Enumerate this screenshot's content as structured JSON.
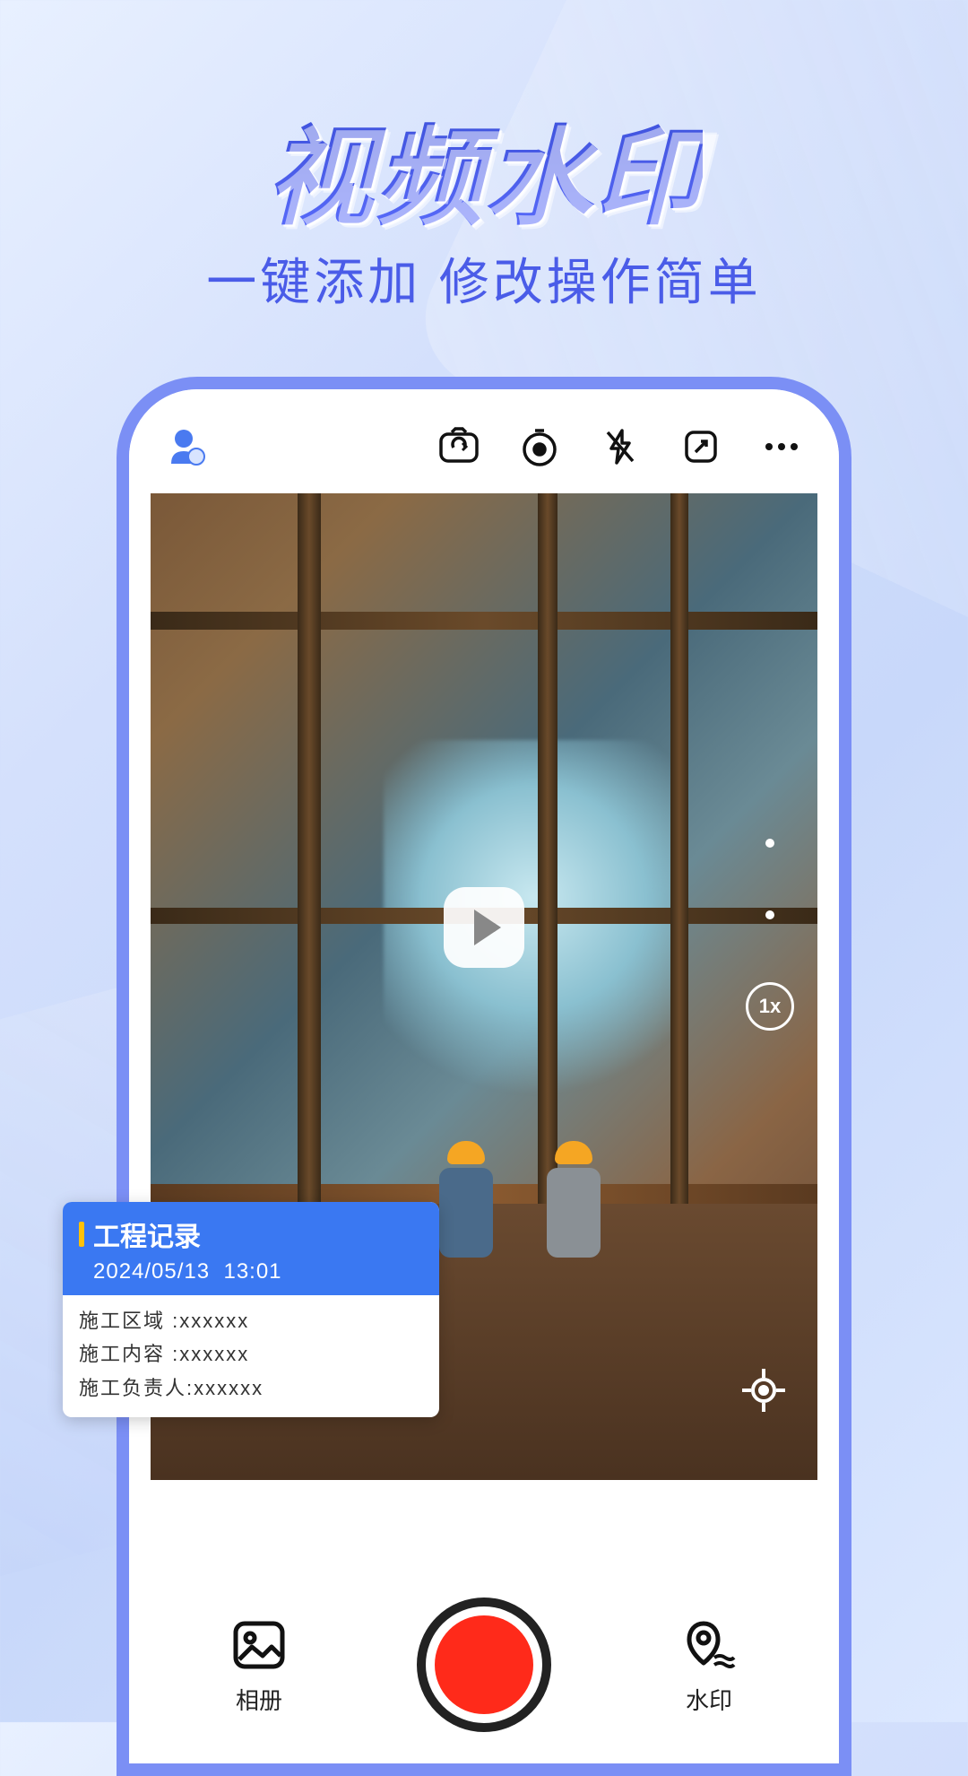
{
  "hero": {
    "title": "视频水印",
    "subtitle": "一键添加  修改操作简单"
  },
  "toolbar": {
    "profile_icon": "profile",
    "switch_camera_icon": "switch-camera",
    "timer_icon": "timer",
    "flash_icon": "flash-off",
    "expand_icon": "expand",
    "more_icon": "more"
  },
  "viewfinder": {
    "zoom_label": "1x"
  },
  "watermark": {
    "title": "工程记录",
    "date": "2024/05/13",
    "time": "13:01",
    "rows": [
      {
        "label": "施工区域",
        "value": "xxxxxx"
      },
      {
        "label": "施工内容",
        "value": "xxxxxx"
      },
      {
        "label": "施工负责人",
        "value": "xxxxxx"
      }
    ]
  },
  "bottom": {
    "gallery_label": "相册",
    "watermark_label": "水印"
  }
}
